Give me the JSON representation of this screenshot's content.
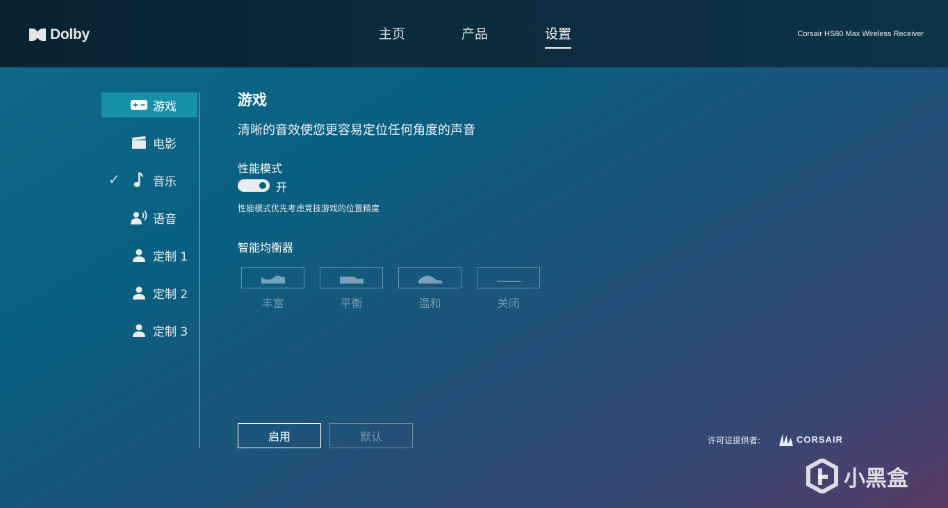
{
  "brand": {
    "logo_text": "Dolby"
  },
  "nav": {
    "items": [
      {
        "label": "主页"
      },
      {
        "label": "产品"
      },
      {
        "label": "设置"
      }
    ],
    "active": "设置"
  },
  "device": {
    "name": "Corsair HS80 Max Wireless Receiver"
  },
  "sidebar": {
    "items": [
      {
        "label": "游戏",
        "icon": "gamepad-icon",
        "active": true
      },
      {
        "label": "电影",
        "icon": "film-clapper-icon"
      },
      {
        "label": "音乐",
        "icon": "music-note-icon",
        "checked": true
      },
      {
        "label": "语音",
        "icon": "voice-icon"
      },
      {
        "label": "定制 1",
        "icon": "user-icon"
      },
      {
        "label": "定制 2",
        "icon": "user-icon"
      },
      {
        "label": "定制 3",
        "icon": "user-icon"
      }
    ]
  },
  "main": {
    "title": "游戏",
    "subtitle": "清晰的音效使您更容易定位任何角度的声音",
    "performance": {
      "label": "性能模式",
      "state": "开",
      "description": "性能模式优先考虑竞技游戏的位置精度"
    },
    "equalizer": {
      "label": "智能均衡器",
      "presets": [
        {
          "label": "丰富",
          "icon": "eq-rich-icon"
        },
        {
          "label": "平衡",
          "icon": "eq-balanced-icon"
        },
        {
          "label": "温和",
          "icon": "eq-warm-icon"
        },
        {
          "label": "关闭",
          "icon": "eq-off-icon"
        }
      ]
    },
    "buttons": {
      "enable": "启用",
      "default": "默认"
    }
  },
  "footer": {
    "provider_label": "许可证提供者:",
    "provider_brand": "CORSAIR",
    "watermark": "小黑盒"
  },
  "colors": {
    "active_tab_bg": "#1890a8",
    "topbar_bg": "#0b2a3b"
  }
}
